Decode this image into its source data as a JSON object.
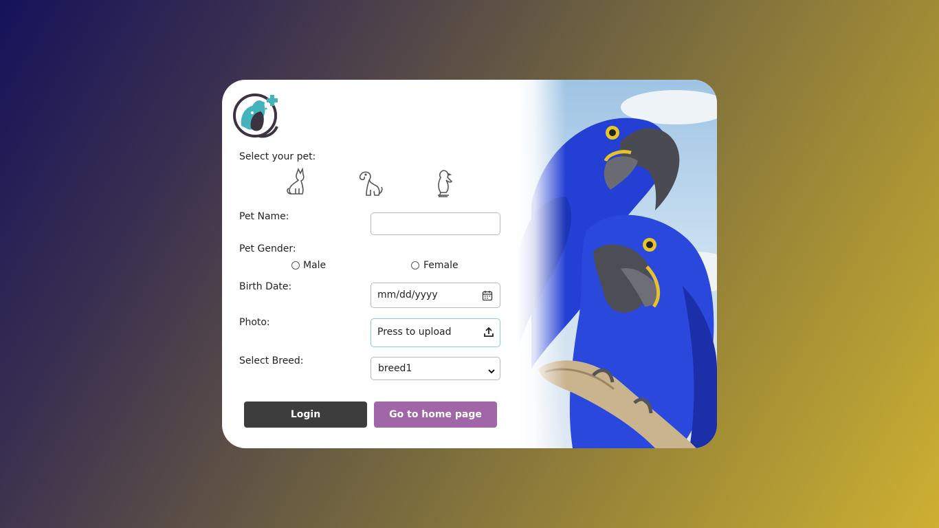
{
  "form": {
    "select_pet_label": "Select your pet:",
    "pets": [
      {
        "name": "cat",
        "icon": "cat-icon"
      },
      {
        "name": "dog",
        "icon": "dog-icon"
      },
      {
        "name": "bird",
        "icon": "bird-icon"
      }
    ],
    "pet_name_label": "Pet Name:",
    "pet_name_value": "",
    "pet_gender_label": "Pet Gender:",
    "gender_male": "Male",
    "gender_female": "Female",
    "birth_date_label": "Birth Date:",
    "birth_date_placeholder": "mm/dd/yyyy",
    "photo_label": "Photo:",
    "photo_upload_text": "Press to upload",
    "breed_label": "Select Breed:",
    "breed_selected": "breed1"
  },
  "buttons": {
    "login": "Login",
    "home": "Go to home page"
  },
  "colors": {
    "login_button": "#3d3d3d",
    "home_button": "#a066a8",
    "photo_field_border": "#7fcfd6",
    "logo_teal": "#45b3bd",
    "logo_dark": "#3b3340",
    "macaw_blue": "#1f3fd0"
  }
}
